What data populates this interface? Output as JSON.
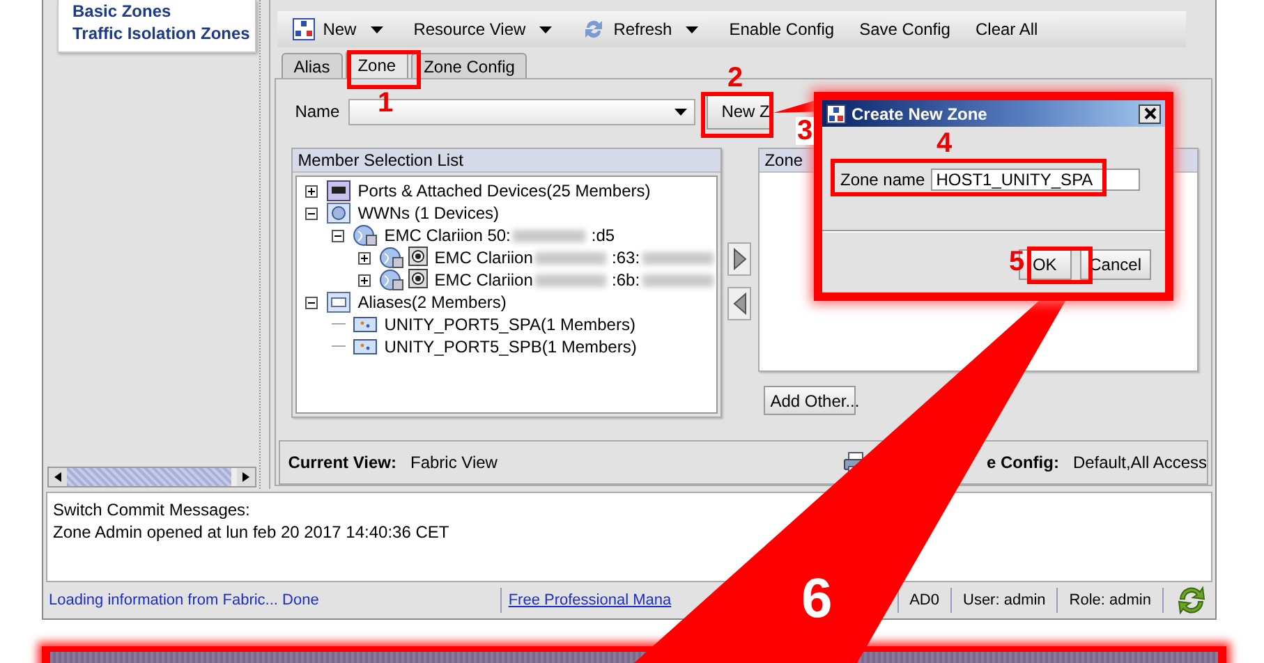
{
  "sidebar": {
    "items": [
      "Basic Zones",
      "Traffic Isolation Zones"
    ]
  },
  "toolbar": [
    {
      "label": "New",
      "kind": "new",
      "menu": true
    },
    {
      "label": "Resource View",
      "kind": "text",
      "menu": true
    },
    {
      "label": "Refresh",
      "kind": "refresh",
      "menu": true
    },
    {
      "label": "Enable Config",
      "kind": "text",
      "menu": false
    },
    {
      "label": "Save Config",
      "kind": "text",
      "menu": false
    },
    {
      "label": "Clear All",
      "kind": "text",
      "menu": false
    }
  ],
  "tabs": [
    {
      "label": "Alias",
      "selected": false
    },
    {
      "label": "Zone",
      "selected": true
    },
    {
      "label": "Zone Config",
      "selected": false
    }
  ],
  "name_field": {
    "label": "Name"
  },
  "new_zone_button": "New Z",
  "member_list": {
    "title": "Member Selection List",
    "tree": [
      {
        "kind": "ports",
        "parts": [
          {
            "kind": "text",
            "text": "Ports & Attached Devices(25 Members)"
          }
        ],
        "expanded": false
      },
      {
        "kind": "wwns",
        "parts": [
          {
            "kind": "text",
            "text": "WWNs (1 Devices)"
          }
        ],
        "expanded": true,
        "children": [
          {
            "kind": "device",
            "parts": [
              {
                "kind": "text",
                "text": "EMC Clariion 50:"
              },
              {
                "kind": "blur"
              },
              {
                "kind": "text",
                "text": ":d5"
              }
            ],
            "expanded": true,
            "children": [
              {
                "kind": "device-port",
                "parts": [
                  {
                    "kind": "text",
                    "text": "EMC Clariion"
                  },
                  {
                    "kind": "blur"
                  },
                  {
                    "kind": "text",
                    "text": ":63:"
                  },
                  {
                    "kind": "blur"
                  }
                ],
                "expanded": false
              },
              {
                "kind": "device-port",
                "parts": [
                  {
                    "kind": "text",
                    "text": "EMC Clariion"
                  },
                  {
                    "kind": "blur"
                  },
                  {
                    "kind": "text",
                    "text": ":6b:"
                  },
                  {
                    "kind": "blur"
                  }
                ],
                "expanded": false
              }
            ]
          }
        ]
      },
      {
        "kind": "aliases",
        "parts": [
          {
            "kind": "text",
            "text": "Aliases(2 Members)"
          }
        ],
        "expanded": true,
        "children": [
          {
            "kind": "alias",
            "parts": [
              {
                "kind": "text",
                "text": "UNITY_PORT5_SPA(1 Members)"
              }
            ]
          },
          {
            "kind": "alias",
            "parts": [
              {
                "kind": "text",
                "text": "UNITY_PORT5_SPB(1 Members)"
              }
            ]
          }
        ]
      }
    ]
  },
  "zone_panel": {
    "title": "Zone"
  },
  "add_other_button": "Add Other...",
  "view_bar": {
    "current_label": "Current View:",
    "current_value": "Fabric View",
    "config_label": "e Config:",
    "config_value": "Default,All Access"
  },
  "messages": [
    "Switch Commit Messages:",
    "Zone Admin opened at lun feb 20 2017 14:40:36 CET"
  ],
  "status_bar": {
    "loading": "Loading information from Fabric... Done",
    "link": "Free Professional Mana",
    "items": [
      "AD0",
      "User: admin",
      "Role: admin"
    ]
  },
  "dialog": {
    "title": "Create New Zone",
    "field_label": "Zone name",
    "field_value": "HOST1_UNITY_SPA",
    "buttons": [
      "OK",
      "Cancel"
    ]
  },
  "annotations": [
    "1",
    "2",
    "3",
    "4",
    "5",
    "6"
  ]
}
